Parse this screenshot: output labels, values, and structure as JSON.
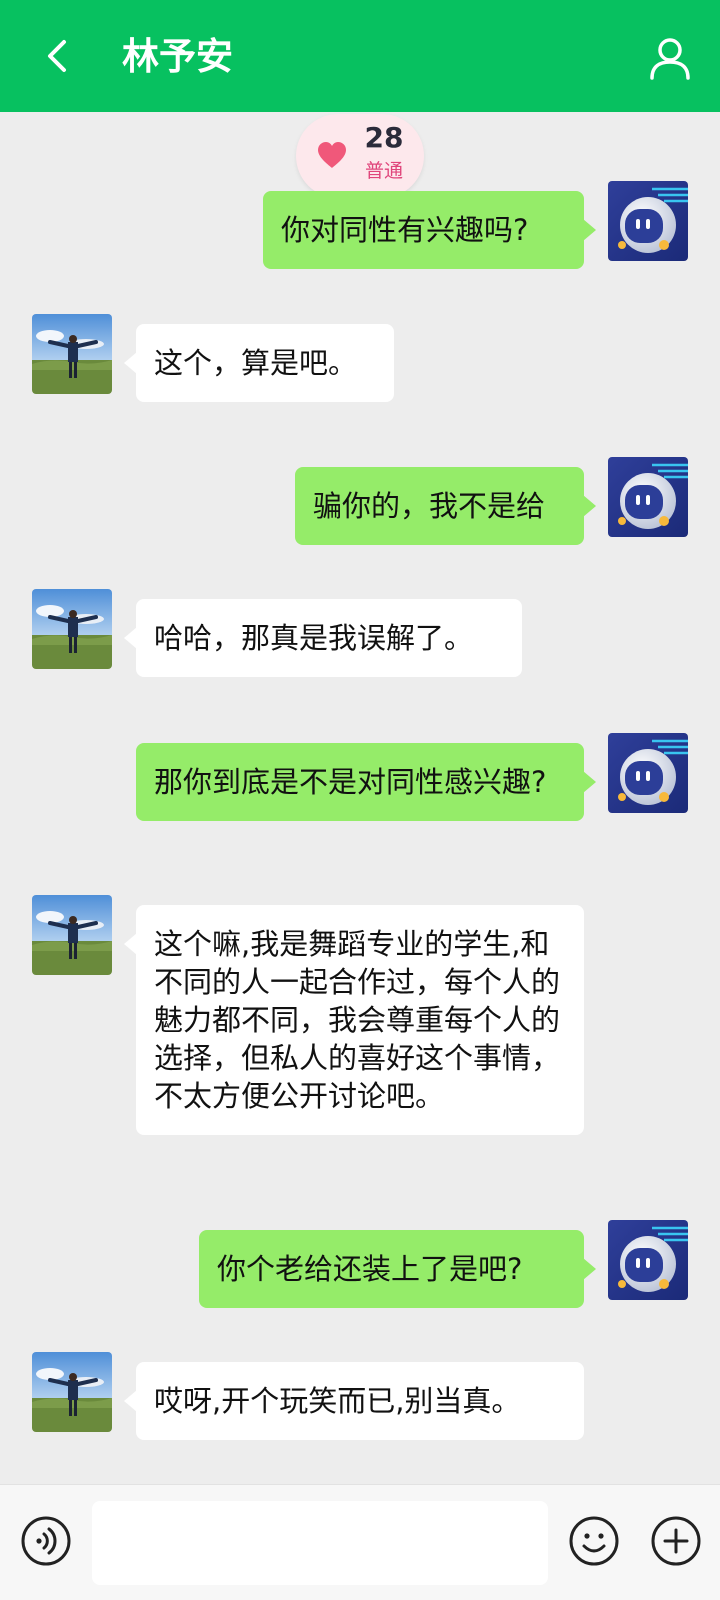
{
  "header": {
    "title": "林予安",
    "bg_color": "#07c160"
  },
  "intimacy": {
    "level": "28",
    "tier": "普通"
  },
  "messages": [
    {
      "side": "sent",
      "text": "你对同性有兴趣吗?"
    },
    {
      "side": "received",
      "text": "这个，算是吧。"
    },
    {
      "side": "sent",
      "text": "骗你的，我不是给"
    },
    {
      "side": "received",
      "text": "哈哈，那真是我误解了。"
    },
    {
      "side": "sent",
      "text": "那你到底是不是对同性感兴趣?"
    },
    {
      "side": "received",
      "text": "这个嘛,我是舞蹈专业的学生,和不同的人一起合作过，每个人的魅力都不同，我会尊重每个人的选择，但私人的喜好这个事情，不太方便公开讨论吧。"
    },
    {
      "side": "sent",
      "text": "你个老给还装上了是吧?"
    },
    {
      "side": "received",
      "text": "哎呀,开个玩笑而已,别当真。"
    }
  ],
  "input": {
    "value": "",
    "placeholder": ""
  },
  "icons": {
    "back": "chevron-left-icon",
    "profile": "person-icon",
    "heart": "heart-icon",
    "voice": "voice-icon",
    "emoji": "smiley-icon",
    "plus": "plus-circle-icon"
  },
  "colors": {
    "sent_bubble": "#95ec69",
    "received_bubble": "#ffffff",
    "background": "#ededed",
    "heart": "#f0587a"
  }
}
